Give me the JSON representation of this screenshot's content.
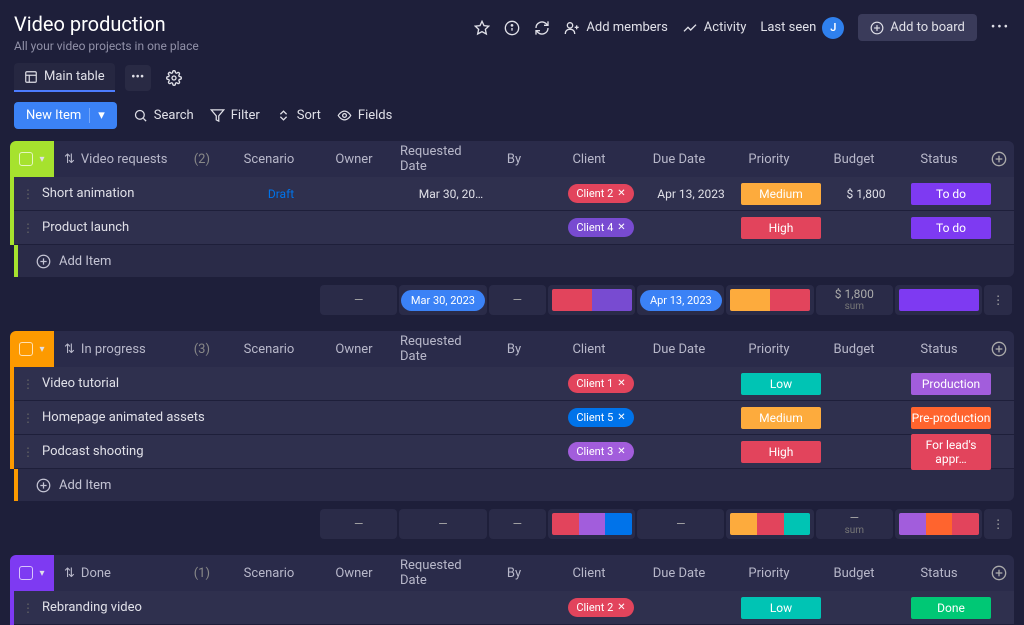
{
  "header": {
    "title": "Video production",
    "subtitle": "All your video projects in one place",
    "addMembers": "Add members",
    "activity": "Activity",
    "lastSeen": "Last seen",
    "avatar": "J",
    "addToBoard": "Add to board"
  },
  "tabs": {
    "main": "Main table"
  },
  "toolbar": {
    "newItem": "New Item",
    "search": "Search",
    "filter": "Filter",
    "sort": "Sort",
    "fields": "Fields"
  },
  "columns": {
    "scenario": "Scenario",
    "owner": "Owner",
    "requested": "Requested Date",
    "by": "By",
    "client": "Client",
    "due": "Due Date",
    "priority": "Priority",
    "budget": "Budget",
    "status": "Status"
  },
  "addItem": "Add Item",
  "groups": [
    {
      "name": "Video requests",
      "count": "(2)",
      "color": "#a6e22e",
      "rows": [
        {
          "name": "Short animation",
          "scenario": "Draft",
          "requested": "Mar 30, 20…",
          "client": {
            "label": "Client 2",
            "bg": "#e2445c"
          },
          "due": "Apr 13, 2023",
          "priority": {
            "label": "Medium",
            "bg": "#fdab3d"
          },
          "budget": "$ 1,800",
          "status": {
            "label": "To do",
            "bg": "#7e3af2"
          }
        },
        {
          "name": "Product launch",
          "client": {
            "label": "Client 4",
            "bg": "#784bd1"
          },
          "priority": {
            "label": "High",
            "bg": "#e2445c"
          },
          "status": {
            "label": "To do",
            "bg": "#7e3af2"
          }
        }
      ],
      "summary": {
        "requested": "Mar 30, 2023",
        "due": "Apr 13, 2023",
        "budget": "$ 1,800",
        "budgetSub": "sum",
        "clientBar": [
          [
            "#e2445c",
            50
          ],
          [
            "#784bd1",
            50
          ]
        ],
        "prioBar": [
          [
            "#fdab3d",
            50
          ],
          [
            "#e2445c",
            50
          ]
        ],
        "statusBar": [
          [
            "#7e3af2",
            100
          ]
        ]
      }
    },
    {
      "name": "In progress",
      "count": "(3)",
      "color": "#fd9a00",
      "rows": [
        {
          "name": "Video tutorial",
          "client": {
            "label": "Client 1",
            "bg": "#e2445c"
          },
          "priority": {
            "label": "Low",
            "bg": "#00c4b4"
          },
          "status": {
            "label": "Production",
            "bg": "#a25ddc"
          }
        },
        {
          "name": "Homepage animated assets",
          "client": {
            "label": "Client 5",
            "bg": "#0073ea"
          },
          "priority": {
            "label": "Medium",
            "bg": "#fdab3d"
          },
          "status": {
            "label": "Pre-production",
            "bg": "#ff642e"
          }
        },
        {
          "name": "Podcast shooting",
          "client": {
            "label": "Client 3",
            "bg": "#a25ddc"
          },
          "priority": {
            "label": "High",
            "bg": "#e2445c"
          },
          "status": {
            "label": "For lead's appr…",
            "bg": "#e2445c"
          }
        }
      ],
      "summary": {
        "budget": "—",
        "budgetSub": "sum",
        "clientBar": [
          [
            "#e2445c",
            34
          ],
          [
            "#a25ddc",
            33
          ],
          [
            "#0073ea",
            33
          ]
        ],
        "prioBar": [
          [
            "#fdab3d",
            34
          ],
          [
            "#e2445c",
            33
          ],
          [
            "#00c4b4",
            33
          ]
        ],
        "statusBar": [
          [
            "#a25ddc",
            34
          ],
          [
            "#ff642e",
            33
          ],
          [
            "#e2445c",
            33
          ]
        ]
      }
    },
    {
      "name": "Done",
      "count": "(1)",
      "color": "#7e3af2",
      "rows": [
        {
          "name": "Rebranding video",
          "client": {
            "label": "Client 2",
            "bg": "#e2445c"
          },
          "priority": {
            "label": "Low",
            "bg": "#00c4b4"
          },
          "status": {
            "label": "Done",
            "bg": "#00c875"
          }
        }
      ]
    }
  ]
}
